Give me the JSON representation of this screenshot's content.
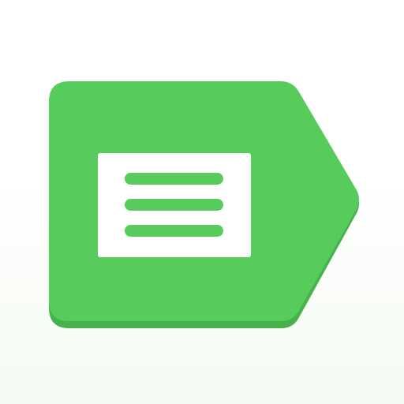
{
  "icon": {
    "name": "green-label-tag-icon",
    "colors": {
      "tag_fill": "#57CC5C",
      "tag_shadow": "#46B24B",
      "card_fill": "#FFFFFF",
      "line_fill": "#57CC5C",
      "background_top": "#FFFFFF",
      "background_bottom": "#F4FAF2"
    }
  }
}
